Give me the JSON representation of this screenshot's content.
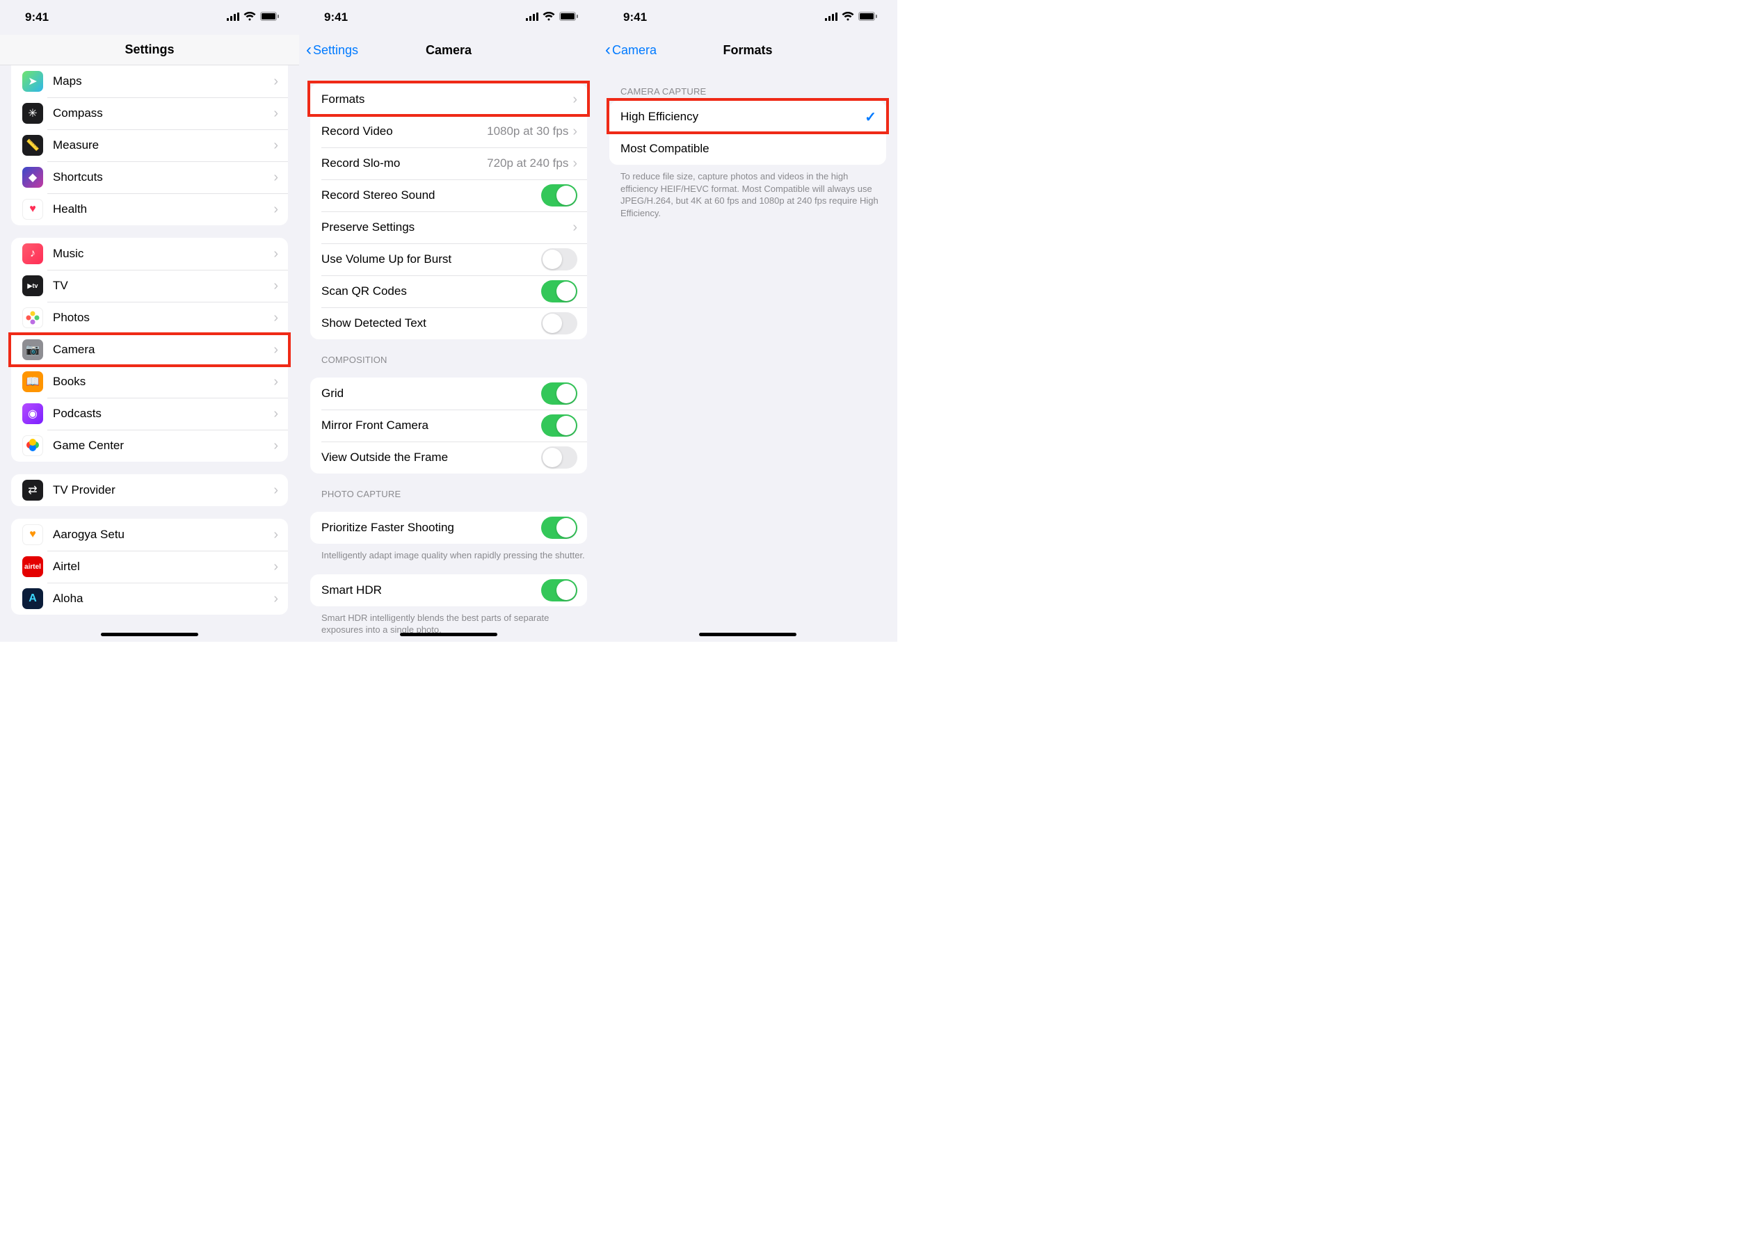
{
  "status": {
    "time": "9:41"
  },
  "screen1": {
    "title": "Settings",
    "groups": [
      {
        "items": [
          {
            "icon": "maps-icon",
            "label": "Maps"
          },
          {
            "icon": "compass-icon",
            "label": "Compass"
          },
          {
            "icon": "measure-icon",
            "label": "Measure"
          },
          {
            "icon": "shortcuts-icon",
            "label": "Shortcuts"
          },
          {
            "icon": "health-icon",
            "label": "Health"
          }
        ]
      },
      {
        "items": [
          {
            "icon": "music-icon",
            "label": "Music"
          },
          {
            "icon": "tv-icon",
            "label": "TV"
          },
          {
            "icon": "photos-icon",
            "label": "Photos"
          },
          {
            "icon": "camera-icon",
            "label": "Camera",
            "highlight": true
          },
          {
            "icon": "books-icon",
            "label": "Books"
          },
          {
            "icon": "podcasts-icon",
            "label": "Podcasts"
          },
          {
            "icon": "gamecenter-icon",
            "label": "Game Center"
          }
        ]
      },
      {
        "items": [
          {
            "icon": "tvprovider-icon",
            "label": "TV Provider"
          }
        ]
      },
      {
        "items": [
          {
            "icon": "aarogya-icon",
            "label": "Aarogya Setu"
          },
          {
            "icon": "airtel-icon",
            "label": "Airtel"
          },
          {
            "icon": "aloha-icon",
            "label": "Aloha"
          }
        ]
      }
    ]
  },
  "screen2": {
    "back": "Settings",
    "title": "Camera",
    "sections": [
      {
        "header": null,
        "footer": null,
        "rows": [
          {
            "label": "Formats",
            "type": "chevron",
            "highlight": true
          },
          {
            "label": "Record Video",
            "detail": "1080p at 30 fps",
            "type": "chevron"
          },
          {
            "label": "Record Slo-mo",
            "detail": "720p at 240 fps",
            "type": "chevron"
          },
          {
            "label": "Record Stereo Sound",
            "type": "toggle",
            "on": true
          },
          {
            "label": "Preserve Settings",
            "type": "chevron"
          },
          {
            "label": "Use Volume Up for Burst",
            "type": "toggle",
            "on": false
          },
          {
            "label": "Scan QR Codes",
            "type": "toggle",
            "on": true
          },
          {
            "label": "Show Detected Text",
            "type": "toggle",
            "on": false
          }
        ]
      },
      {
        "header": "COMPOSITION",
        "footer": null,
        "rows": [
          {
            "label": "Grid",
            "type": "toggle",
            "on": true
          },
          {
            "label": "Mirror Front Camera",
            "type": "toggle",
            "on": true
          },
          {
            "label": "View Outside the Frame",
            "type": "toggle",
            "on": false
          }
        ]
      },
      {
        "header": "PHOTO CAPTURE",
        "footer": "Intelligently adapt image quality when rapidly pressing the shutter.",
        "rows": [
          {
            "label": "Prioritize Faster Shooting",
            "type": "toggle",
            "on": true
          }
        ]
      },
      {
        "header": null,
        "footer": "Smart HDR intelligently blends the best parts of separate exposures into a single photo.",
        "rows": [
          {
            "label": "Smart HDR",
            "type": "toggle",
            "on": true
          }
        ]
      }
    ]
  },
  "screen3": {
    "back": "Camera",
    "title": "Formats",
    "section_header": "CAMERA CAPTURE",
    "rows": [
      {
        "label": "High Efficiency",
        "selected": true,
        "highlight": true
      },
      {
        "label": "Most Compatible",
        "selected": false
      }
    ],
    "footer": "To reduce file size, capture photos and videos in the high efficiency HEIF/HEVC format. Most Compatible will always use JPEG/H.264, but 4K at 60 fps and 1080p at 240 fps require High Efficiency."
  }
}
